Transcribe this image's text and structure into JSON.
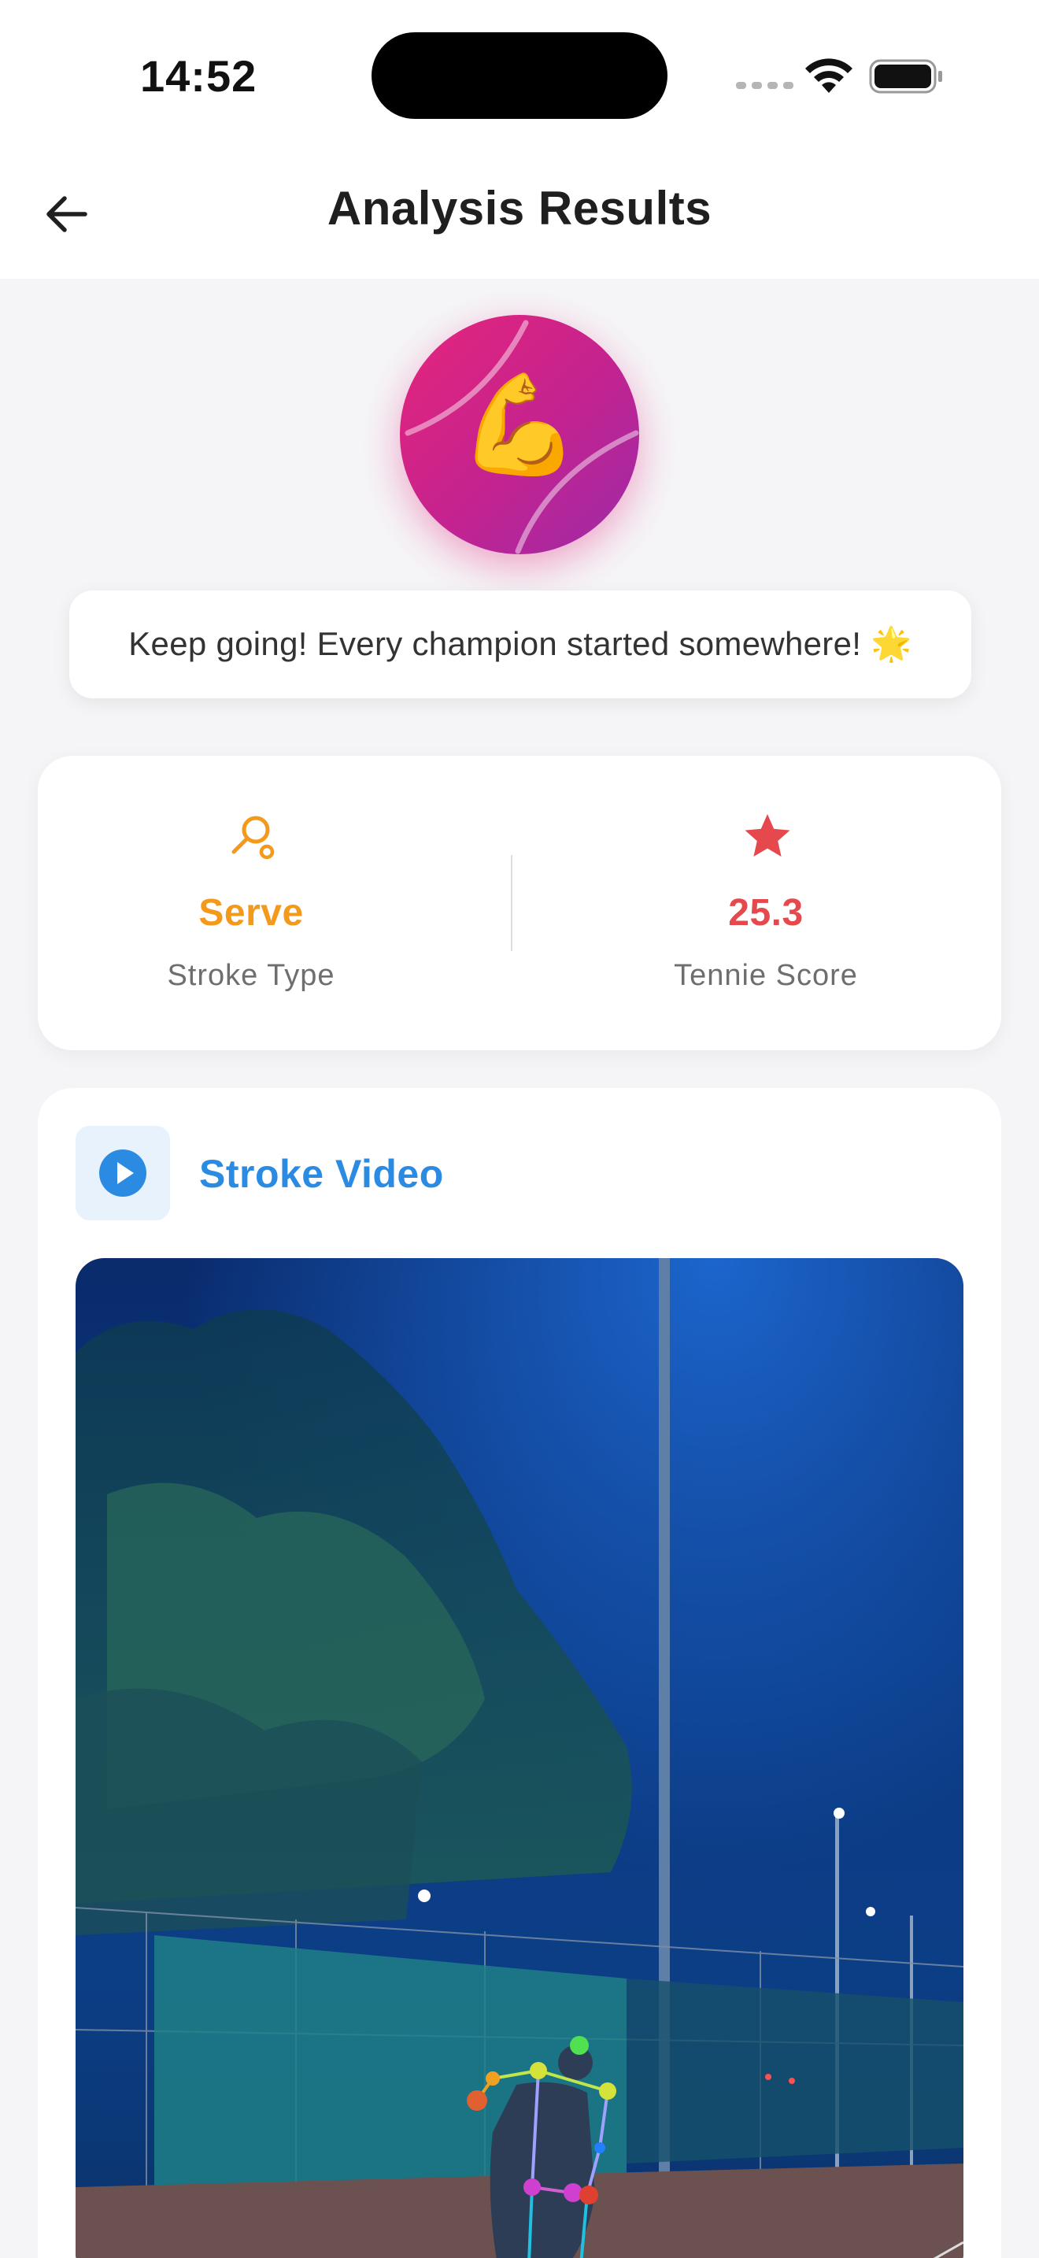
{
  "status_bar": {
    "time": "14:52"
  },
  "header": {
    "title": "Analysis Results",
    "back_icon": "arrow-left-icon"
  },
  "hero": {
    "icon": "tennis-ball-icon",
    "emoji": "💪"
  },
  "motivation": {
    "text": "Keep going! Every champion started somewhere! 🌟"
  },
  "stats": {
    "stroke": {
      "icon": "racket-icon",
      "value": "Serve",
      "label": "Stroke Type",
      "color": "#f39a1c"
    },
    "score": {
      "icon": "star-icon",
      "value": "25.3",
      "label": "Tennie Score",
      "color": "#e5484d"
    }
  },
  "video": {
    "title": "Stroke Video",
    "icon": "play-circle-icon",
    "accent": "#2b8be2"
  }
}
